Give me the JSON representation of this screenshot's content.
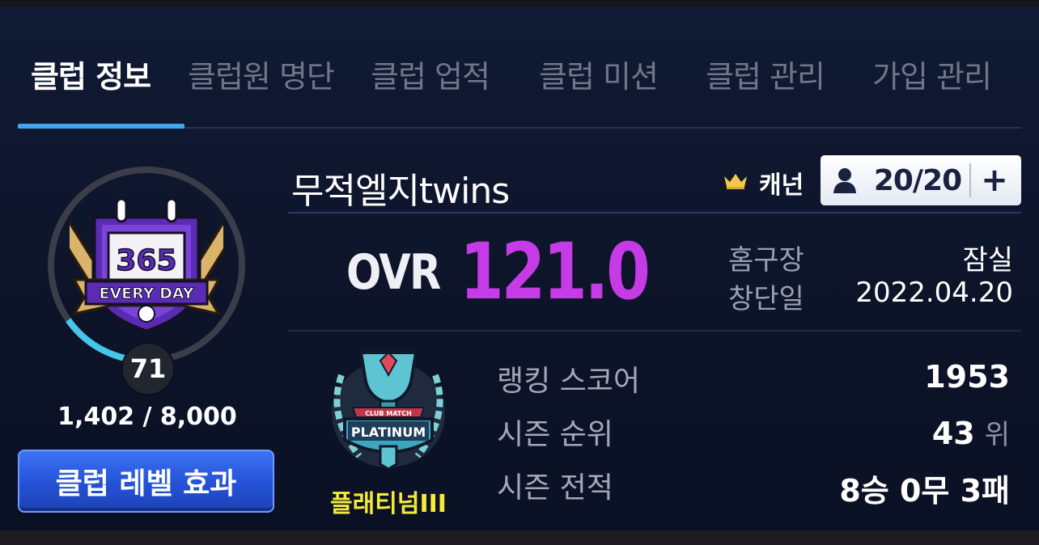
{
  "tabs": [
    {
      "label": "클럽 정보",
      "active": true
    },
    {
      "label": "클럽원 명단",
      "active": false
    },
    {
      "label": "클럽 업적",
      "active": false
    },
    {
      "label": "클럽 미션",
      "active": false
    },
    {
      "label": "클럽 관리",
      "active": false
    },
    {
      "label": "가입 관리",
      "active": false
    }
  ],
  "level": {
    "badge_number": "365",
    "badge_text": "EVERY DAY",
    "value": "71",
    "exp": "1,402 / 8,000",
    "progress": 0.175
  },
  "level_effect_button": "클럽 레벨 효과",
  "club": {
    "name": "무적엘지twins",
    "captain_label": "캐넌",
    "members": "20/20",
    "add_label": "+"
  },
  "ovr": {
    "label": "OVR",
    "value": "121.0"
  },
  "info": {
    "stadium_label": "홈구장",
    "stadium_value": "잠실",
    "founded_label": "창단일",
    "founded_value": "2022.04.20"
  },
  "rank": {
    "emblem_top": "CLUB MATCH",
    "emblem_text": "PLATINUM",
    "tier": "플래티넘III",
    "score_label": "랭킹 스코어",
    "score_value": "1953",
    "season_rank_label": "시즌 순위",
    "season_rank_value": "43",
    "season_rank_unit": "위",
    "record_label": "시즌 전적",
    "record_value": "8승 0무 3패"
  },
  "colors": {
    "accent_blue": "#3ea7f0",
    "ovr_purple": "#c53be6",
    "tier_yellow": "#f4ea3a"
  }
}
